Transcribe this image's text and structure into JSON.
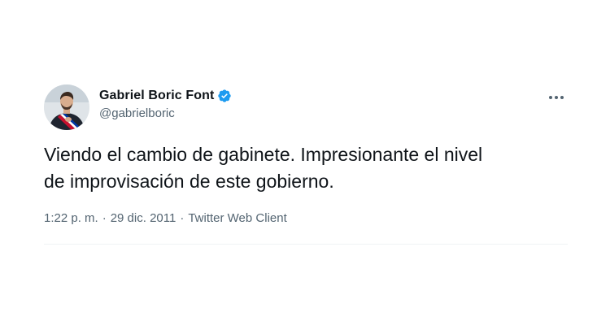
{
  "tweet": {
    "author": {
      "display_name": "Gabriel Boric Font",
      "handle": "@gabrielboric",
      "verified": true
    },
    "text": "Viendo el cambio de gabinete. Impresionante el nivel\nde improvisación de este gobierno.",
    "meta": {
      "time": "1:22 p. m.",
      "separator": "·",
      "date": "29 dic. 2011",
      "source": "Twitter Web Client"
    }
  },
  "icons": {
    "verified": "verified-badge-icon",
    "more": "more-options-icon"
  },
  "colors": {
    "verified_blue": "#1d9bf0",
    "text": "#0f1419",
    "secondary": "#536471"
  }
}
